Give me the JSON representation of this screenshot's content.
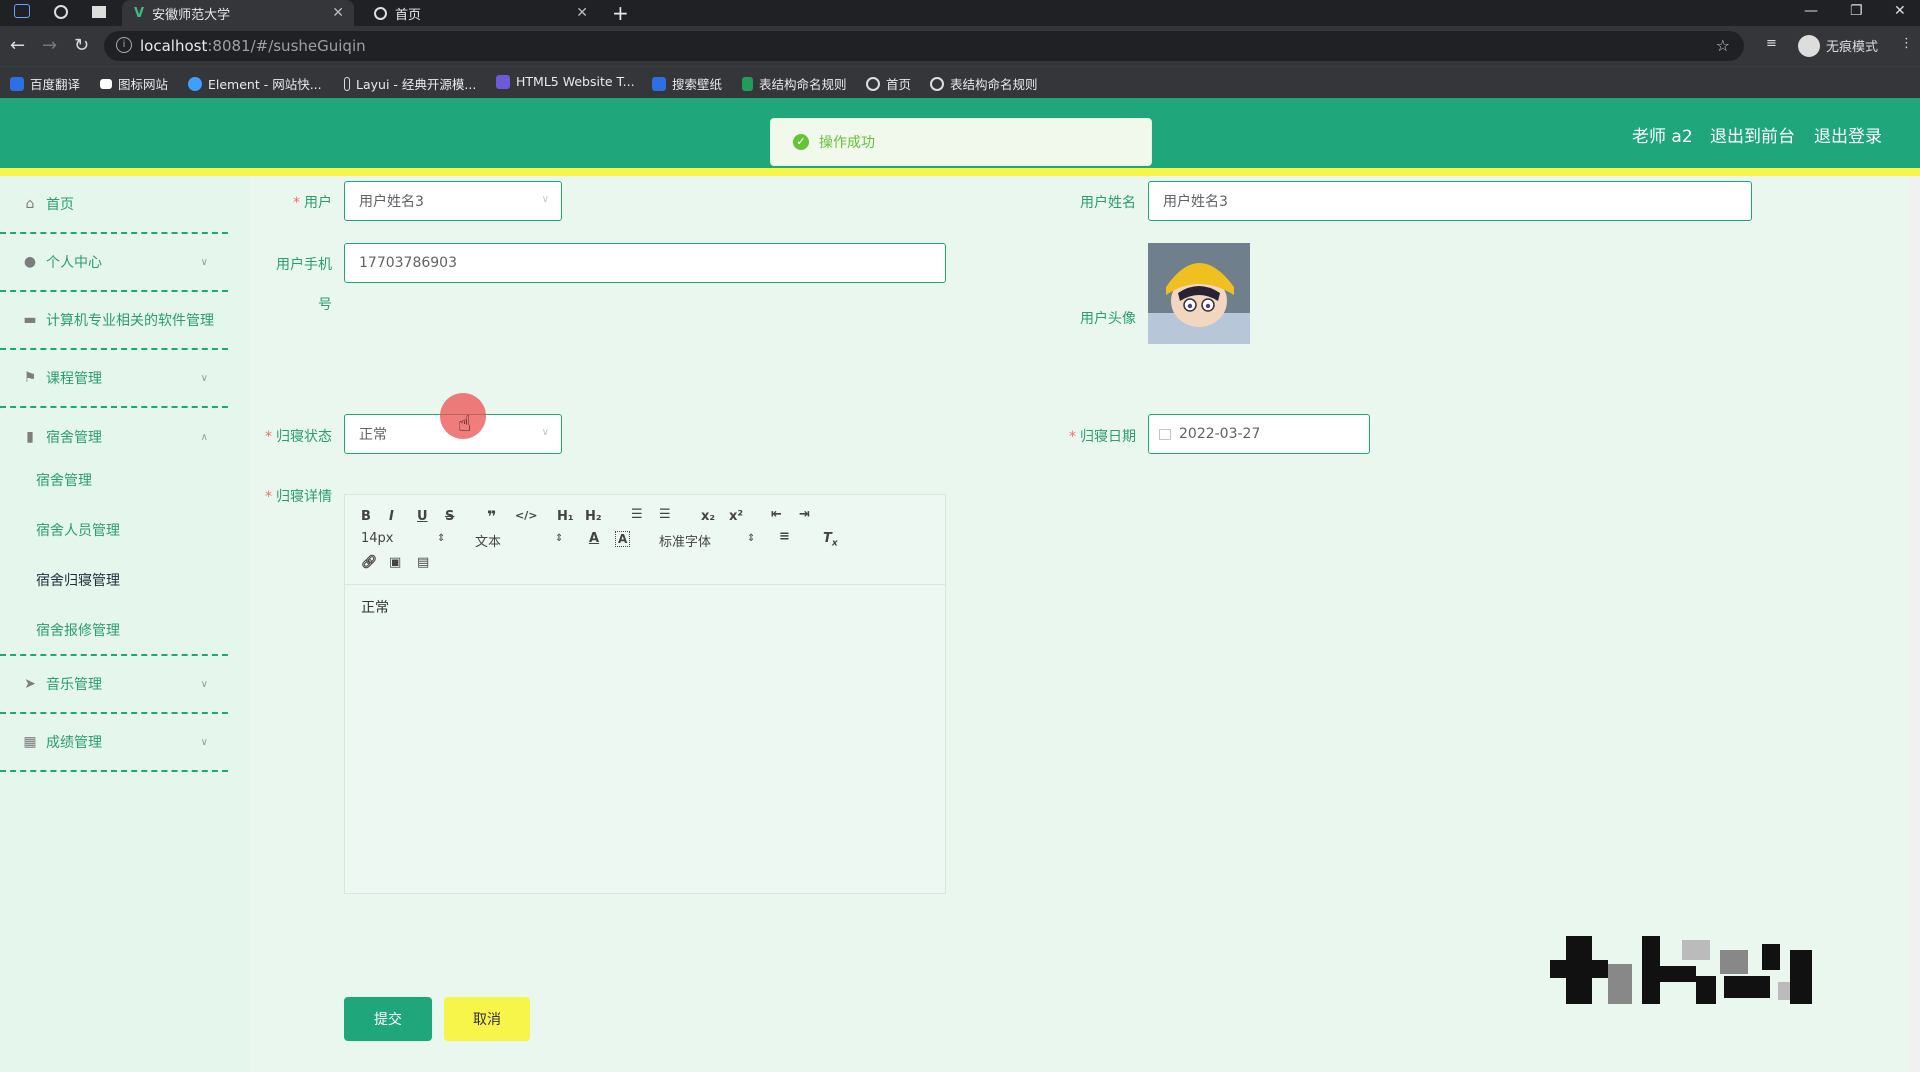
{
  "browser": {
    "tabs": [
      {
        "title": "安徽师范大学",
        "active": true
      },
      {
        "title": "首页",
        "active": false
      }
    ],
    "url_host": "localhost",
    "url_path": ":8081/#/susheGuiqin",
    "profile_label": "无痕模式",
    "bookmarks": [
      "百度翻译",
      "图标网站",
      "Element - 网站快...",
      "Layui - 经典开源模...",
      "HTML5 Website T...",
      "搜索壁纸",
      "表结构命名规则",
      "首页",
      "表结构命名规则"
    ]
  },
  "header": {
    "user_label": "老师 a2",
    "front_link": "退出到前台",
    "logout_link": "退出登录"
  },
  "toast": {
    "message": "操作成功"
  },
  "sidebar": {
    "items": [
      {
        "label": "首页",
        "icon": "home-icon",
        "expandable": false
      },
      {
        "label": "个人中心",
        "icon": "user-icon",
        "expandable": true
      },
      {
        "label": "计算机专业相关的软件管理",
        "icon": "briefcase-icon",
        "expandable": false
      },
      {
        "label": "课程管理",
        "icon": "flag-icon",
        "expandable": true
      },
      {
        "label": "宿舍管理",
        "icon": "bar-chart-icon",
        "expandable": true,
        "expanded": true
      },
      {
        "label": "音乐管理",
        "icon": "send-icon",
        "expandable": true
      },
      {
        "label": "成绩管理",
        "icon": "grid-icon",
        "expandable": true
      }
    ],
    "subitems": [
      "宿舍管理",
      "宿舍人员管理",
      "宿舍归寝管理",
      "宿舍报修管理"
    ],
    "current_subitem": "宿舍归寝管理"
  },
  "form": {
    "user_label": "用户",
    "user_value": "用户姓名3",
    "user_name_label": "用户姓名",
    "user_name_value": "用户姓名3",
    "phone_label_line1": "用户手机",
    "phone_label_line2": "号",
    "phone_value": "17703786903",
    "avatar_label": "用户头像",
    "status_label": "归寝状态",
    "status_value": "正常",
    "date_label": "归寝日期",
    "date_value": "2022-03-27",
    "detail_label": "归寝详情",
    "editor_font_size": "14px",
    "editor_block": "文本",
    "editor_font": "标准字体",
    "detail_value": "正常",
    "submit_label": "提交",
    "cancel_label": "取消"
  },
  "colors": {
    "primary": "#1fa67a",
    "accent": "#f7f44a",
    "success": "#67c23a"
  }
}
